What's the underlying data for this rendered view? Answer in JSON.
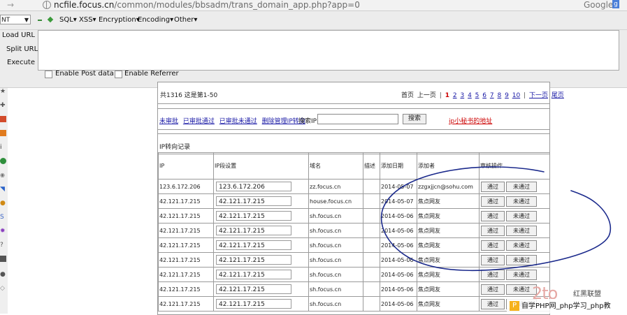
{
  "browser": {
    "url_host": "ncfile.focus.cn",
    "url_path": "/common/modules/bbsadm/trans_domain_app.php?app=0",
    "search_engine": "Google"
  },
  "hackbar": {
    "select_value": "NT",
    "menus": [
      "SQL",
      "XSS",
      "Encryption",
      "Encoding",
      "Other"
    ],
    "buttons": [
      "Load URL",
      "Split URL",
      "Execute"
    ],
    "checkboxes": [
      "Enable Post data",
      "Enable Referrer"
    ]
  },
  "pager": {
    "summary": "共1316  这是第1-50",
    "first": "首页",
    "prev": "上一页",
    "pages": [
      "1",
      "2",
      "3",
      "4",
      "5",
      "6",
      "7",
      "8",
      "9",
      "10"
    ],
    "current_page": "1",
    "next": "下一页",
    "last": "尾页"
  },
  "filters": {
    "links": [
      "未审批",
      "已审批通过",
      "已审批未通过",
      "删除管理IP转向"
    ],
    "search_label": "搜索IP:",
    "search_button": "搜索",
    "ip_link": "ip小秘书的地址"
  },
  "record_title": "IP转向记录",
  "table": {
    "columns": [
      "IP",
      "IP段设置",
      "域名",
      "描述",
      "添加日期",
      "添加者",
      "审核操作"
    ],
    "pass_label": "通过",
    "fail_label": "未通过",
    "rows": [
      {
        "ip": "123.6.172.206",
        "ip_range": "123.6.172.206",
        "domain": "zz.focus.cn",
        "desc": "",
        "date": "2014-05-07",
        "adder": "zzgxjjcn@sohu.com"
      },
      {
        "ip": "42.121.17.215",
        "ip_range": "42.121.17.215",
        "domain": "house.focus.cn",
        "desc": "",
        "date": "2014-05-07",
        "adder": "焦点网友"
      },
      {
        "ip": "42.121.17.215",
        "ip_range": "42.121.17.215",
        "domain": "sh.focus.cn",
        "desc": "",
        "date": "2014-05-06",
        "adder": "焦点网友"
      },
      {
        "ip": "42.121.17.215",
        "ip_range": "42.121.17.215",
        "domain": "sh.focus.cn",
        "desc": "",
        "date": "2014-05-06",
        "adder": "焦点网友"
      },
      {
        "ip": "42.121.17.215",
        "ip_range": "42.121.17.215",
        "domain": "sh.focus.cn",
        "desc": "",
        "date": "2014-05-06",
        "adder": "焦点网友"
      },
      {
        "ip": "42.121.17.215",
        "ip_range": "42.121.17.215",
        "domain": "sh.focus.cn",
        "desc": "",
        "date": "2014-05-06",
        "adder": "焦点网友"
      },
      {
        "ip": "42.121.17.215",
        "ip_range": "42.121.17.215",
        "domain": "sh.focus.cn",
        "desc": "",
        "date": "2014-05-06",
        "adder": "焦点网友"
      },
      {
        "ip": "42.121.17.215",
        "ip_range": "42.121.17.215",
        "domain": "sh.focus.cn",
        "desc": "",
        "date": "2014-05-06",
        "adder": "焦点网友"
      },
      {
        "ip": "42.121.17.215",
        "ip_range": "42.121.17.215",
        "domain": "sh.focus.cn",
        "desc": "",
        "date": "2014-05-06",
        "adder": "焦点网友"
      }
    ]
  },
  "watermark": {
    "logo": "2to",
    "tag": "红黑联盟",
    "bar": "自学PHP网_php学习_php教"
  },
  "colors": {
    "link": "#1a1aa6",
    "current_page": "#cc0000",
    "scribble": "#1b2a8c"
  }
}
